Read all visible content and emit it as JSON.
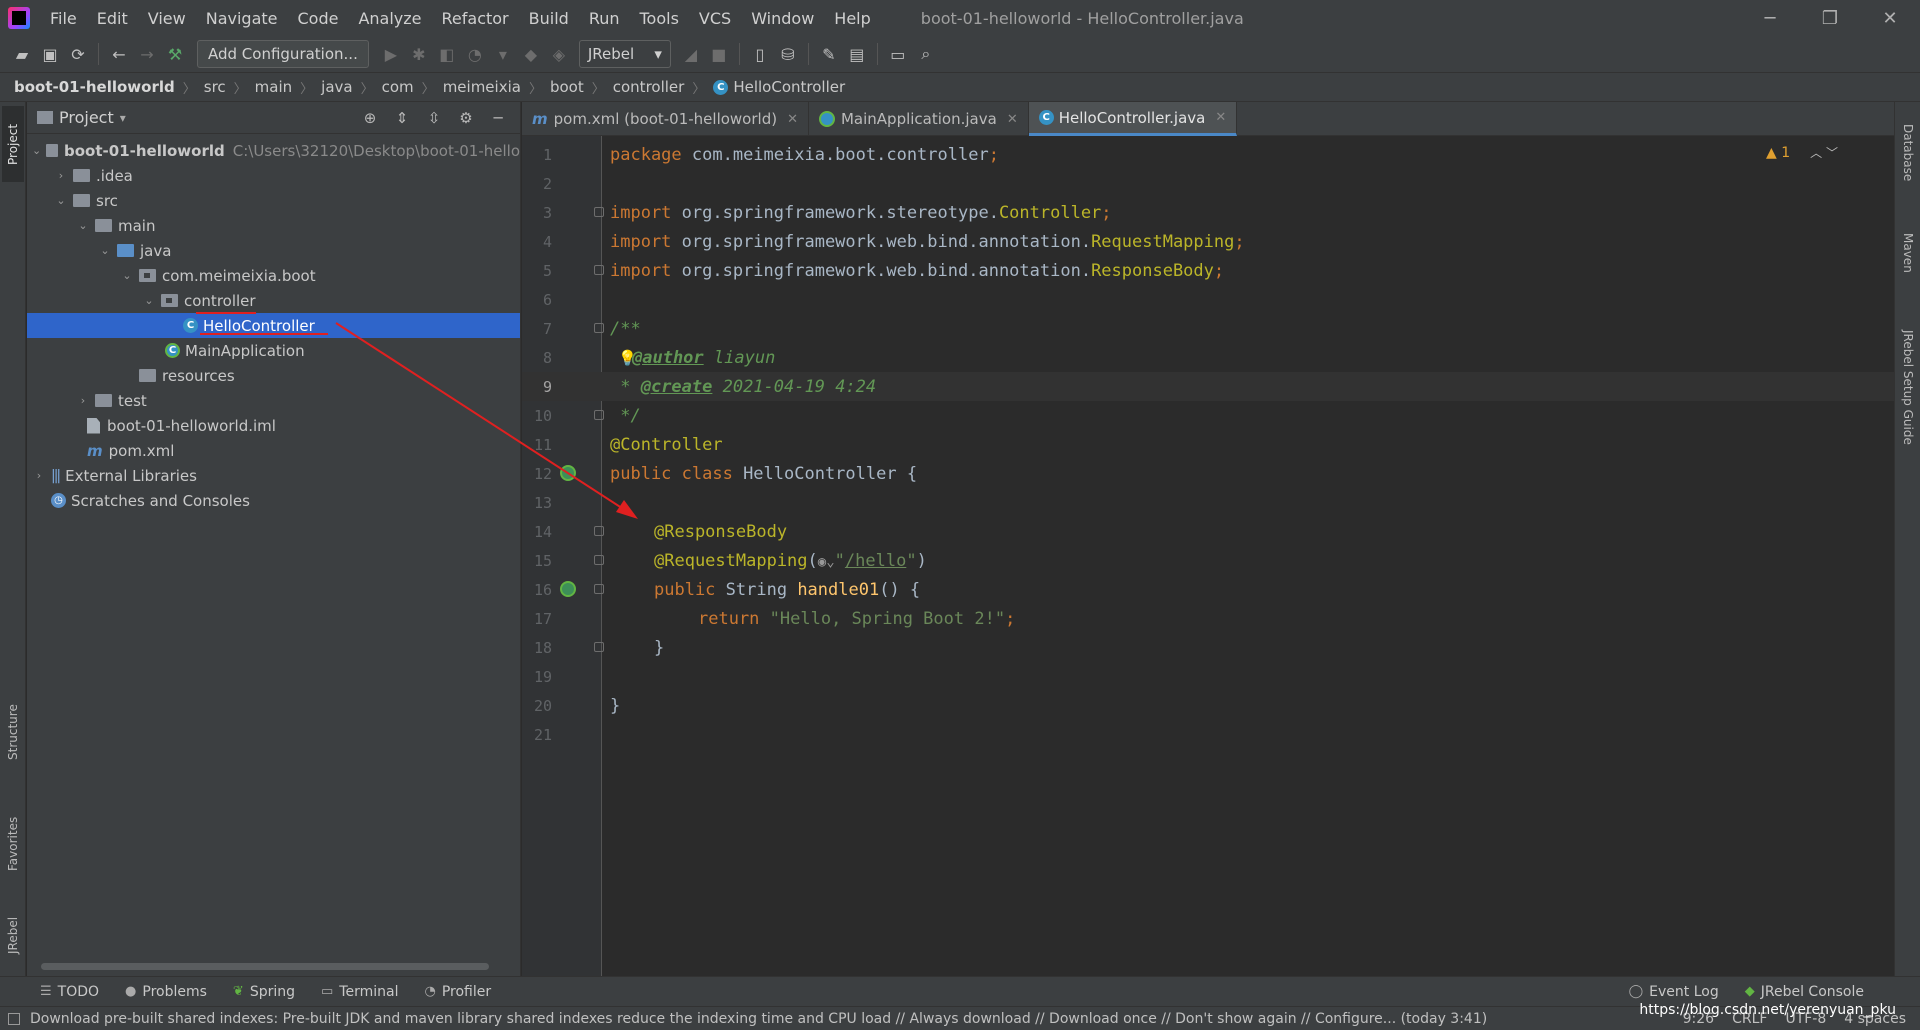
{
  "menubar": {
    "items": [
      "File",
      "Edit",
      "View",
      "Navigate",
      "Code",
      "Analyze",
      "Refactor",
      "Build",
      "Run",
      "Tools",
      "VCS",
      "Window",
      "Help"
    ],
    "window_title": "boot-01-helloworld - HelloController.java"
  },
  "toolbar": {
    "add_config_label": "Add Configuration...",
    "jrebel_label": "JRebel"
  },
  "breadcrumb": [
    "boot-01-helloworld",
    "src",
    "main",
    "java",
    "com",
    "meimeixia",
    "boot",
    "controller",
    "HelloController"
  ],
  "left_tabs": [
    "Project",
    "Structure",
    "Favorites",
    "JRebel"
  ],
  "right_tabs": [
    "Database",
    "Maven",
    "JRebel Setup Guide"
  ],
  "project": {
    "title": "Project",
    "root_name": "boot-01-helloworld",
    "root_path": "C:\\Users\\32120\\Desktop\\boot-01-hello",
    "items": {
      "idea": ".idea",
      "src": "src",
      "main": "main",
      "java": "java",
      "pkg": "com.meimeixia.boot",
      "controller": "controller",
      "hello_controller": "HelloController",
      "main_application": "MainApplication",
      "resources": "resources",
      "test": "test",
      "iml": "boot-01-helloworld.iml",
      "pom": "pom.xml",
      "ext_libs": "External Libraries",
      "scratches": "Scratches and Consoles"
    }
  },
  "editor": {
    "tabs": [
      {
        "label": "pom.xml (boot-01-helloworld)"
      },
      {
        "label": "MainApplication.java"
      },
      {
        "label": "HelloController.java"
      }
    ],
    "warning_count": "1",
    "code": {
      "l1_kw": "package",
      "l1_rest": " com.meimeixia.boot.controller",
      "semi": ";",
      "import_kw": "import",
      "l3_pkg": " org.springframework.stereotype.",
      "l3_cls": "Controller",
      "l4_pkg": " org.springframework.web.bind.annotation.",
      "l4_cls": "RequestMapping",
      "l5_pkg": " org.springframework.web.bind.annotation.",
      "l5_cls": "ResponseBody",
      "l7": "/**",
      "l8_tag": "@author",
      "l8_val": " liayun",
      "l9_star": " * ",
      "l9_tag": "@create",
      "l9_val": " 2021-04-19 4:24",
      "l10": " */",
      "l11": "@Controller",
      "l12_kw": "public class",
      "l12_name": " HelloController {",
      "l14": "@ResponseBody",
      "l15_ann": "@RequestMapping",
      "l15_open": "(",
      "l15_q1": "\"",
      "l15_path": "/hello",
      "l15_q2": "\"",
      "l15_close": ")",
      "l16_kw": "public",
      "l16_type": " String ",
      "l16_fn": "handle01",
      "l16_rest": "() {",
      "l17_kw": "return",
      "l17_str": " \"Hello, Spring Boot 2!\"",
      "l18": "}",
      "l20": "}"
    },
    "line_numbers": [
      "1",
      "2",
      "3",
      "4",
      "5",
      "6",
      "7",
      "8",
      "9",
      "10",
      "11",
      "12",
      "13",
      "14",
      "15",
      "16",
      "17",
      "18",
      "19",
      "20",
      "21"
    ]
  },
  "bottom_tools": [
    "TODO",
    "Problems",
    "Spring",
    "Terminal",
    "Profiler"
  ],
  "bottom_right_tools": [
    "Event Log",
    "JRebel Console"
  ],
  "status": {
    "message": "Download pre-built shared indexes: Pre-built JDK and maven library shared indexes reduce the indexing time and CPU load // Always download // Download once // Don't show again // Configure... (today 3:41)",
    "position": "9:26",
    "line_sep": "CRLF",
    "encoding": "UTF-8",
    "indent": "4 spaces"
  },
  "watermark": "https://blog.csdn.net/yerenyuan_pku"
}
